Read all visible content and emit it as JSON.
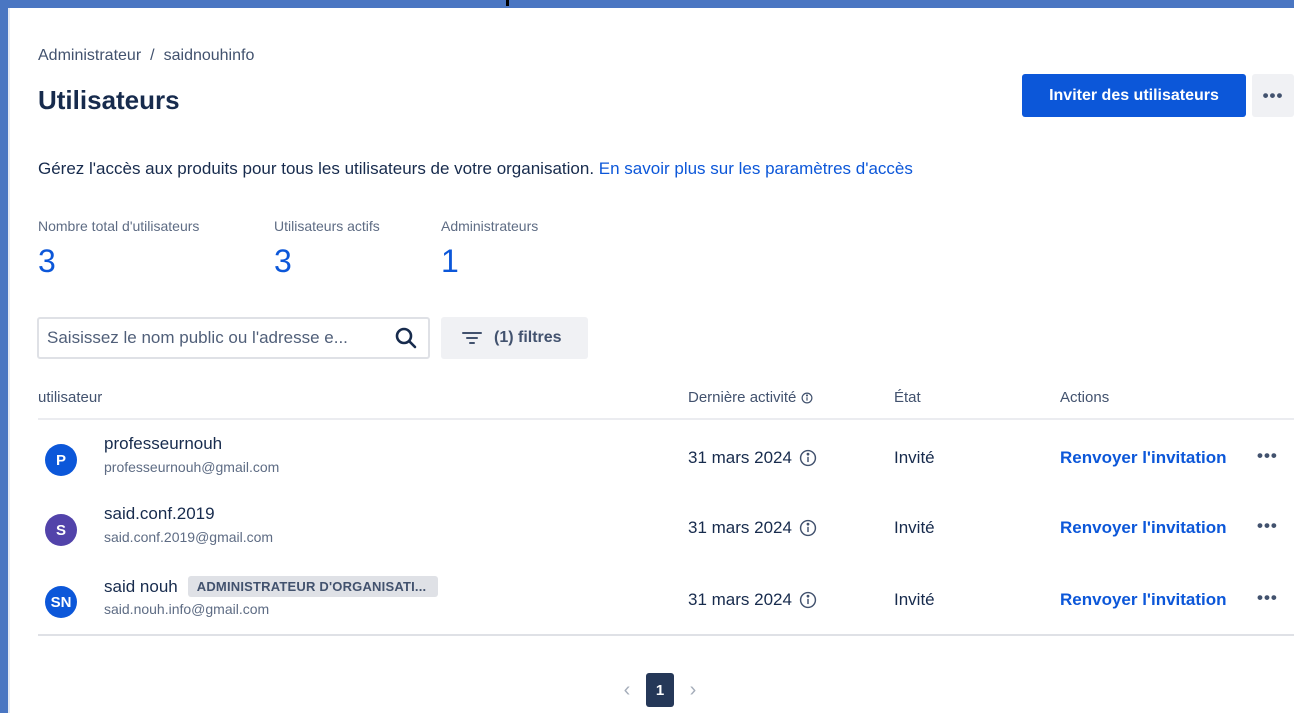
{
  "breadcrumb": {
    "root": "Administrateur",
    "separator": "/",
    "current": "saidnouhinfo"
  },
  "page": {
    "title": "Utilisateurs"
  },
  "header": {
    "invite_label": "Inviter des utilisateurs",
    "more_label": "•••"
  },
  "description": {
    "text": "Gérez l'accès aux produits pour tous les utilisateurs de votre organisation.",
    "link": "En savoir plus sur les paramètres d'accès"
  },
  "stats": [
    {
      "label": "Nombre total d'utilisateurs",
      "value": "3"
    },
    {
      "label": "Utilisateurs actifs",
      "value": "3"
    },
    {
      "label": "Administrateurs",
      "value": "1"
    }
  ],
  "search": {
    "placeholder": "Saisissez le nom public ou l'adresse e..."
  },
  "filter": {
    "label": "(1) filtres"
  },
  "table": {
    "columns": {
      "user": "utilisateur",
      "last_activity": "Dernière activité",
      "state": "État",
      "actions": "Actions"
    },
    "rows": [
      {
        "initials": "P",
        "avatar_color": "#0c57d9",
        "name": "professeurnouh",
        "email": "professeurnouh@gmail.com",
        "badge": "",
        "date": "31 mars 2024",
        "state": "Invité",
        "action": "Renvoyer l'invitation",
        "more": "•••"
      },
      {
        "initials": "S",
        "avatar_color": "#5243aa",
        "name": "said.conf.2019",
        "email": "said.conf.2019@gmail.com",
        "badge": "",
        "date": "31 mars 2024",
        "state": "Invité",
        "action": "Renvoyer l'invitation",
        "more": "•••"
      },
      {
        "initials": "SN",
        "avatar_color": "#0c57d9",
        "name": "said nouh",
        "email": "said.nouh.info@gmail.com",
        "badge": "ADMINISTRATEUR D'ORGANISATI...",
        "date": "31 mars 2024",
        "state": "Invité",
        "action": "Renvoyer l'invitation",
        "more": "•••"
      }
    ]
  },
  "pagination": {
    "current_page": "1",
    "prev": "‹",
    "next": "›"
  },
  "colors": {
    "primary": "#0c57d9",
    "frame": "#4a76c2",
    "pager_active": "#253858"
  }
}
